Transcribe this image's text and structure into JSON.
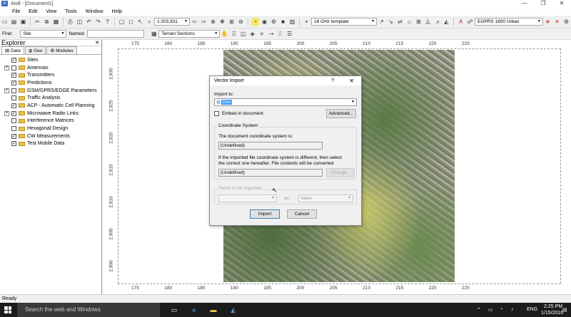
{
  "window": {
    "title": "Atoll - [Document1]",
    "controls": [
      "—",
      "❐",
      "✕"
    ]
  },
  "menu": [
    "File",
    "Edit",
    "View",
    "Tools",
    "Window",
    "Help"
  ],
  "toolbar": {
    "zoom_value": "1:203,931",
    "template": "18 GHz template",
    "radio_config": "EGPRS 1800 Urban"
  },
  "findbar": {
    "find_label": "Find:",
    "find_value": "Site",
    "named_label": "Named:",
    "terrain_sections": "Terrain Sections"
  },
  "explorer": {
    "title": "Explorer",
    "tabs": [
      "Data",
      "Geo",
      "Modules"
    ],
    "items": [
      {
        "label": "Sites",
        "expander": "",
        "check": "✓",
        "icon": "folder"
      },
      {
        "label": "Antennas",
        "expander": "+",
        "check": "",
        "icon": "folder"
      },
      {
        "label": "Transmitters",
        "expander": "",
        "check": "✓",
        "icon": "folder"
      },
      {
        "label": "Predictions",
        "expander": "",
        "check": "✓",
        "icon": "folder"
      },
      {
        "label": "GSM/GPRS/EDGE Parameters",
        "expander": "+",
        "check": "",
        "icon": "folder"
      },
      {
        "label": "Traffic Analysis",
        "expander": "",
        "check": "",
        "icon": "folder"
      },
      {
        "label": "ACP - Automatic Cell Planning",
        "expander": "",
        "check": "✓",
        "icon": "folder"
      },
      {
        "label": "Microwave Radio Links",
        "expander": "+",
        "check": "✓",
        "icon": "folder"
      },
      {
        "label": "Interference Matrices",
        "expander": "",
        "check": "",
        "icon": "folder"
      },
      {
        "label": "Hexagonal Design",
        "expander": "",
        "check": "",
        "icon": "folder"
      },
      {
        "label": "CW Measurements",
        "expander": "",
        "check": "✓",
        "icon": "folder"
      },
      {
        "label": "Test Mobile Data",
        "expander": "",
        "check": "✓",
        "icon": "folder"
      }
    ]
  },
  "map": {
    "x_ticks": [
      "175",
      "180",
      "185",
      "190",
      "195",
      "200",
      "205",
      "210",
      "215",
      "220",
      "225"
    ],
    "y_ticks": [
      "2,930",
      "2,925",
      "2,920",
      "2,915",
      "2,910",
      "2,905",
      "2,900"
    ]
  },
  "dialog": {
    "title": "Vector Import",
    "help": "?",
    "close": "✕",
    "import_to_label": "Import to:",
    "import_to_value": "Geo",
    "embed_label": "Embed in document",
    "advanced": "Advanced...",
    "coord_group": "Coordinate System",
    "doc_cs_text": "The document coordinate system is:",
    "doc_cs_value": "(Undefined)",
    "note_line1": "If the imported file coordinate system is different, then select",
    "note_line2": "the correct one hereafter. File contents will be converted",
    "file_cs_value": "(Undefined)",
    "change": "Change...",
    "fields_group": "Fields to be imported",
    "as_label": "as :",
    "value_option": "Value",
    "import": "Import",
    "cancel": "Cancel"
  },
  "status": {
    "text": "Ready"
  },
  "taskbar": {
    "search_placeholder": "Search the web and Windows",
    "lang": "ENG",
    "time": "2:25 PM",
    "date": "1/15/2016"
  }
}
